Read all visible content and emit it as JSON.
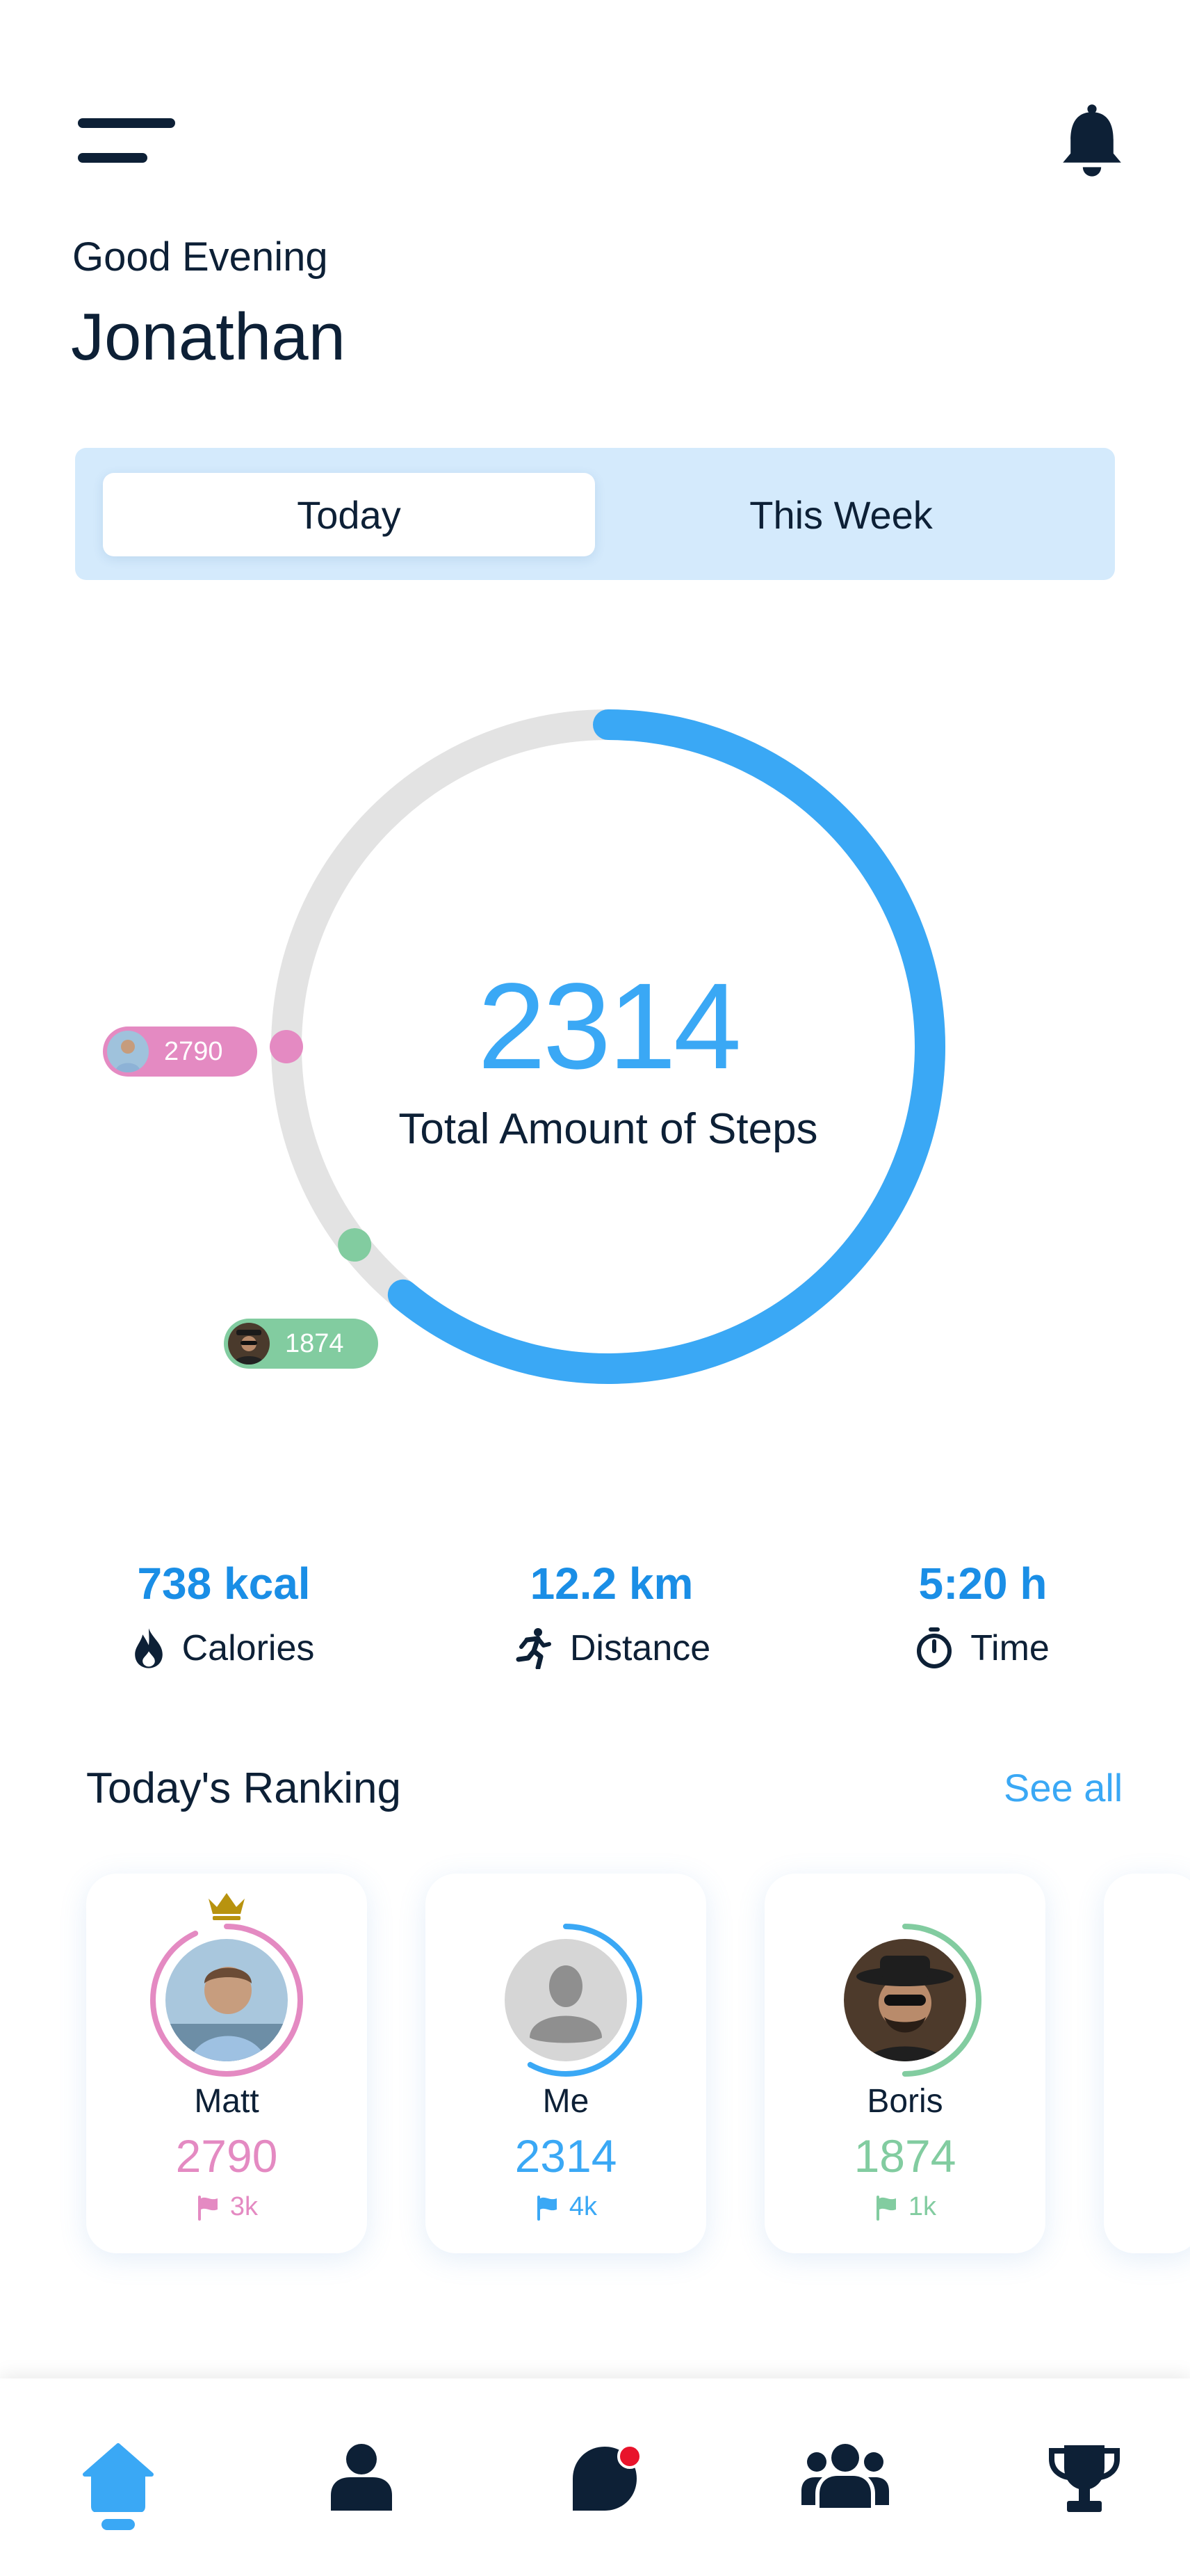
{
  "header": {
    "menu_icon": "hamburger-menu-icon",
    "bell_icon": "bell-icon",
    "greeting": "Good Evening",
    "user_name": "Jonathan"
  },
  "period_tabs": [
    {
      "label": "Today",
      "selected": true
    },
    {
      "label": "This Week",
      "selected": false
    }
  ],
  "steps": {
    "value": "2314",
    "label": "Total Amount of Steps",
    "progress_fraction": 0.61,
    "markers": [
      {
        "name": "Matt",
        "value": "2790",
        "color": "#e48ac2"
      },
      {
        "name": "Boris",
        "value": "1874",
        "color": "#82cca0"
      }
    ]
  },
  "stats": [
    {
      "value": "738 kcal",
      "label": "Calories",
      "icon": "flame-icon"
    },
    {
      "value": "12.2 km",
      "label": "Distance",
      "icon": "running-icon"
    },
    {
      "value": "5:20 h",
      "label": "Time",
      "icon": "stopwatch-icon"
    }
  ],
  "ranking": {
    "title": "Today's Ranking",
    "see_all": "See all",
    "cards": [
      {
        "name": "Matt",
        "score": "2790",
        "goal": "3k",
        "color": "#e48ac2",
        "progress_fraction": 0.93,
        "crown": true
      },
      {
        "name": "Me",
        "score": "2314",
        "goal": "4k",
        "color": "#3aa8f5",
        "progress_fraction": 0.58
      },
      {
        "name": "Boris",
        "score": "1874",
        "goal": "1k",
        "color": "#82cca0",
        "progress_fraction": 0.5
      }
    ]
  },
  "bottom_nav": [
    {
      "icon": "home-icon",
      "active": true
    },
    {
      "icon": "profile-icon",
      "active": false
    },
    {
      "icon": "chat-icon",
      "active": false,
      "badge": true
    },
    {
      "icon": "groups-icon",
      "active": false
    },
    {
      "icon": "trophy-icon",
      "active": false
    }
  ],
  "colors": {
    "accent": "#3aa8f5",
    "dark": "#0d2036",
    "pink": "#e48ac2",
    "green": "#82cca0",
    "tab_bg": "#d4eafc",
    "ring_track": "#e3e3e3"
  }
}
